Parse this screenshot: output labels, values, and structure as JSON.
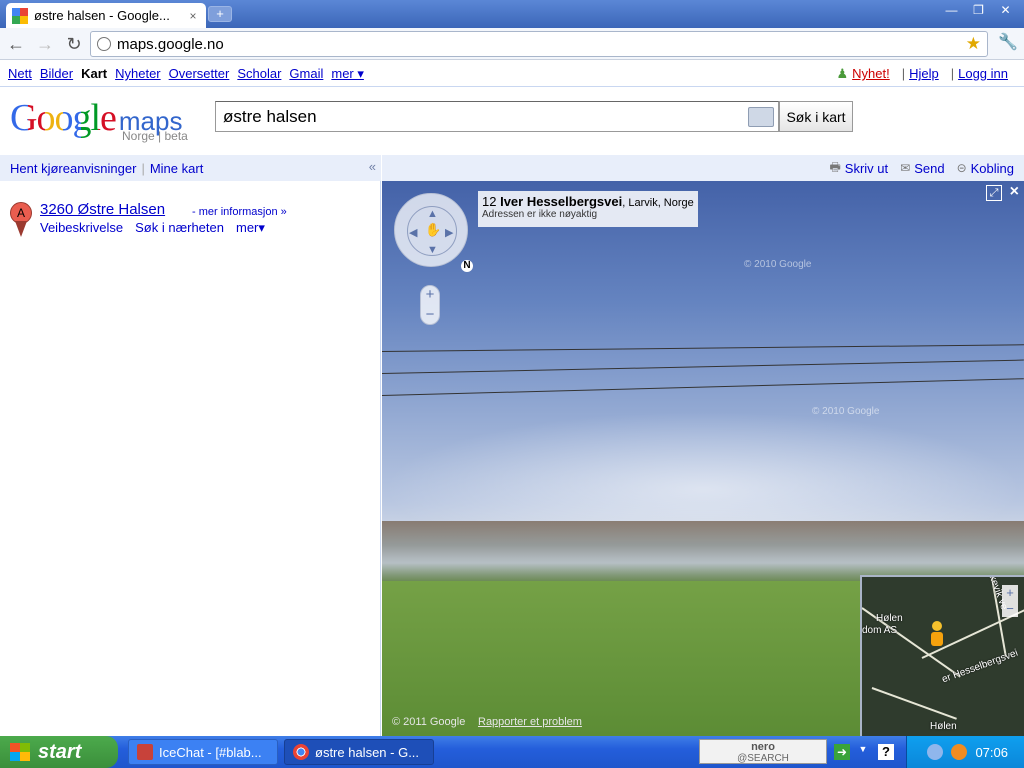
{
  "browser": {
    "tab_title": "østre halsen - Google...",
    "tab_close": "×",
    "new_tab": "+",
    "url": "maps.google.no",
    "back": "←",
    "forward": "→",
    "reload": "↻",
    "star": "★",
    "wrench": "🔧",
    "minimize": "—",
    "restore": "❐",
    "close": "✕"
  },
  "gbar": {
    "links": [
      "Nett",
      "Bilder",
      "Kart",
      "Nyheter",
      "Oversetter",
      "Scholar",
      "Gmail",
      "mer ▾"
    ],
    "active": "Kart",
    "nyhet": "Nyhet!",
    "hjelp": "Hjelp",
    "logg_inn": "Logg inn",
    "separator": "|"
  },
  "header": {
    "logo_google": "Google",
    "logo_maps": "maps",
    "logo_sub": "Norge | beta",
    "search_value": "østre halsen",
    "search_button": "Søk i kart"
  },
  "panel": {
    "directions": "Hent kjøreanvisninger",
    "my_maps": "Mine kart",
    "pipe": "|",
    "collapse": "«",
    "result": {
      "marker": "A",
      "title": "3260 Østre Halsen",
      "more_info": "- mer informasjon »",
      "links": [
        "Veibeskrivelse",
        "Søk i nærheten",
        "mer▾"
      ]
    }
  },
  "map_header": {
    "print": "Skriv ut",
    "send": "Send",
    "link": "Kobling",
    "print_icon": "🖶",
    "send_icon": "✉",
    "link_icon": "⊝"
  },
  "streetview": {
    "address_number": "12",
    "address_street": "Iver Hesselbergsvei",
    "address_city": ", Larvik, Norge",
    "address_note": "Adressen er ikke nøyaktig",
    "watermark": "© 2010 Google",
    "copyright": "© 2011 Google",
    "report": "Rapporter et problem",
    "zoom_in": "+",
    "zoom_out": "−",
    "compass": "N",
    "fullscreen": "⤢",
    "close": "×",
    "hand": "✋"
  },
  "minimap": {
    "label_holen_top": "Hølen",
    "label_dom": "dom AS",
    "label_street": "er Hesselbergsvei",
    "label_holen_bottom": "Hølen",
    "label_vertical": "kevik ve",
    "zoom_in": "+",
    "zoom_out": "−"
  },
  "taskbar": {
    "start": "start",
    "task1": "IceChat - [#blab...",
    "task2": "østre halsen - G...",
    "nero_top": "nero",
    "nero_bottom": "@SEARCH",
    "clock": "07:06"
  }
}
